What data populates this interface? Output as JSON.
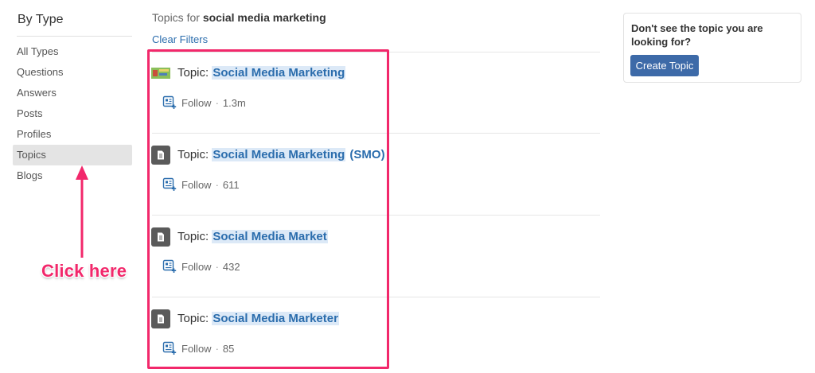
{
  "sidebar": {
    "title": "By Type",
    "items": [
      {
        "label": "All Types",
        "active": false
      },
      {
        "label": "Questions",
        "active": false
      },
      {
        "label": "Answers",
        "active": false
      },
      {
        "label": "Posts",
        "active": false
      },
      {
        "label": "Profiles",
        "active": false
      },
      {
        "label": "Topics",
        "active": true
      },
      {
        "label": "Blogs",
        "active": false
      }
    ]
  },
  "annotation": {
    "text": "Click here",
    "color": "#f2286b"
  },
  "main": {
    "header_prefix": "Topics for",
    "query": "social media marketing",
    "clear_filters": "Clear Filters",
    "topic_prefix": "Topic:",
    "follow_label": "Follow",
    "separator": "·",
    "results": [
      {
        "name": "Social Media Marketing",
        "suffix": "",
        "count": "1.3m",
        "thumb": "image-thumbnail"
      },
      {
        "name": "Social Media Marketing",
        "suffix": " (SMO)",
        "count": "611",
        "thumb": "document-icon"
      },
      {
        "name": "Social Media Market",
        "suffix": "",
        "count": "432",
        "thumb": "document-icon"
      },
      {
        "name": "Social Media Marketer",
        "suffix": "",
        "count": "85",
        "thumb": "document-icon"
      }
    ]
  },
  "panel": {
    "text": "Don't see the topic you are looking for?",
    "button": "Create Topic"
  },
  "colors": {
    "link": "#2b6dad",
    "button": "#3d6aa8",
    "highlight": "#f2286b",
    "active_bg": "#e4e4e4"
  }
}
